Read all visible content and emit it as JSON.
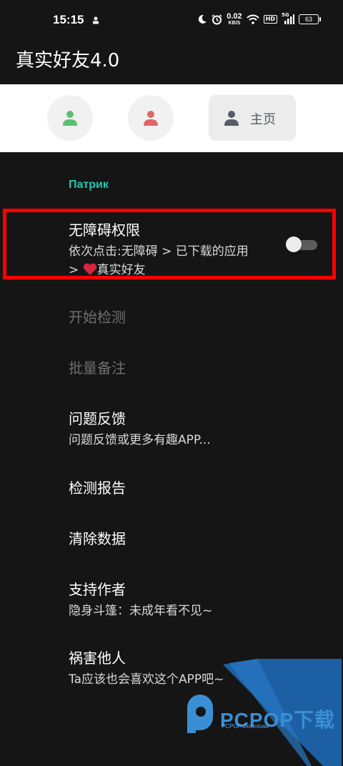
{
  "status_bar": {
    "time": "15:15",
    "net_speed_value": "0.02",
    "net_speed_unit": "KB/S",
    "hd_label": "HD",
    "signal_label": "5G",
    "battery": "63"
  },
  "app": {
    "title": "真实好友4.0"
  },
  "tabs": {
    "home_label": "主页"
  },
  "colors": {
    "accent": "#1ec7b1",
    "highlight": "#ff0000",
    "tab1_icon": "#5cbf72",
    "tab2_icon": "#e06767",
    "tab_home_icon": "#555c66"
  },
  "section": {
    "label": "Патрик"
  },
  "items": [
    {
      "title": "无障碍权限",
      "subtitle_line1": "依次点击:无障碍 > 已下载的应用",
      "subtitle_line2_prefix": ">",
      "subtitle_line2_suffix": "真实好友",
      "toggle_on": false
    },
    {
      "title": "开始检测"
    },
    {
      "title": "批量备注"
    },
    {
      "title": "问题反馈",
      "subtitle": "问题反馈或更多有趣APP..."
    },
    {
      "title": "检测报告"
    },
    {
      "title": "清除数据"
    },
    {
      "title": "支持作者",
      "subtitle": "隐身斗篷：未成年看不见~"
    },
    {
      "title": "祸害他人",
      "subtitle": "Ta应该也会喜欢这个APP吧~"
    }
  ],
  "watermark": {
    "text": "PCPOP下载",
    "sub": "PCPOP Download"
  }
}
